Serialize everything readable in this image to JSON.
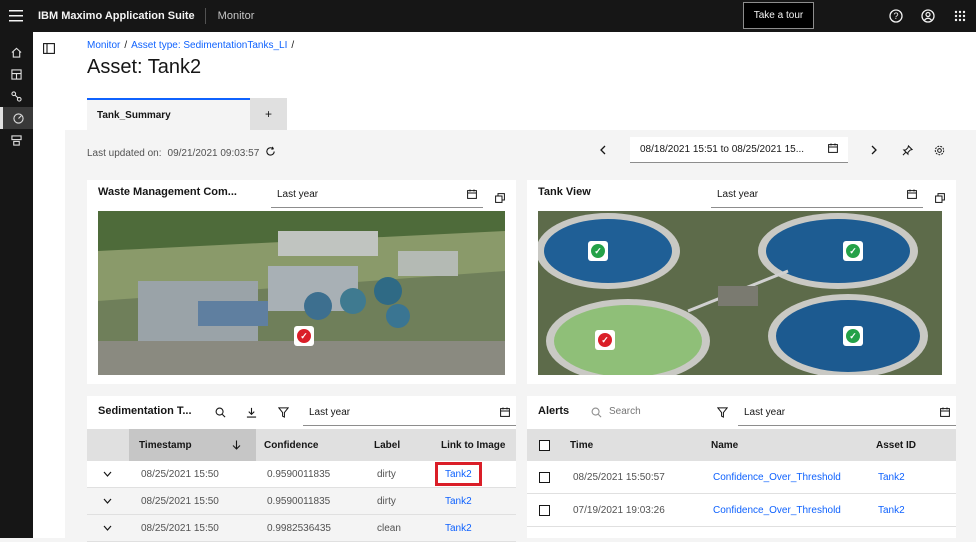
{
  "topbar": {
    "brand_bold": "IBM Maximo Application Suite",
    "app": "Monitor",
    "tour": "Take a tour"
  },
  "breadcrumb": {
    "item1": "Monitor",
    "item2": "Asset type: SedimentationTanks_LI",
    "sep": "/"
  },
  "page_title": "Asset: Tank2",
  "tabs": {
    "tab1": "Tank_Summary",
    "add": "+"
  },
  "updated": {
    "label": "Last updated on:",
    "value": "09/21/2021 09:03:57"
  },
  "daterange": "08/18/2021 15:51 to 08/25/2021 15...",
  "card_waste": {
    "title": "Waste Management Com...",
    "range": "Last year"
  },
  "card_tank": {
    "title": "Tank View",
    "range": "Last year"
  },
  "card_sed": {
    "title": "Sedimentation T...",
    "range": "Last year",
    "headers": {
      "timestamp": "Timestamp",
      "confidence": "Confidence",
      "label": "Label",
      "link": "Link to Image"
    },
    "rows": [
      {
        "timestamp": "08/25/2021 15:50",
        "confidence": "0.9590011835",
        "label": "dirty",
        "link": "Tank2"
      },
      {
        "timestamp": "08/25/2021 15:50",
        "confidence": "0.9590011835",
        "label": "dirty",
        "link": "Tank2"
      },
      {
        "timestamp": "08/25/2021 15:50",
        "confidence": "0.9982536435",
        "label": "clean",
        "link": "Tank2"
      }
    ]
  },
  "card_alerts": {
    "title": "Alerts",
    "search_placeholder": "Search",
    "range": "Last year",
    "headers": {
      "time": "Time",
      "name": "Name",
      "asset": "Asset ID"
    },
    "rows": [
      {
        "time": "08/25/2021 15:50:57",
        "name": "Confidence_Over_Threshold",
        "asset": "Tank2"
      },
      {
        "time": "07/19/2021 19:03:26",
        "name": "Confidence_Over_Threshold",
        "asset": "Tank2"
      }
    ]
  },
  "colors": {
    "accent": "#0f62fe",
    "highlight": "#da1e28",
    "ok": "#24a148"
  }
}
